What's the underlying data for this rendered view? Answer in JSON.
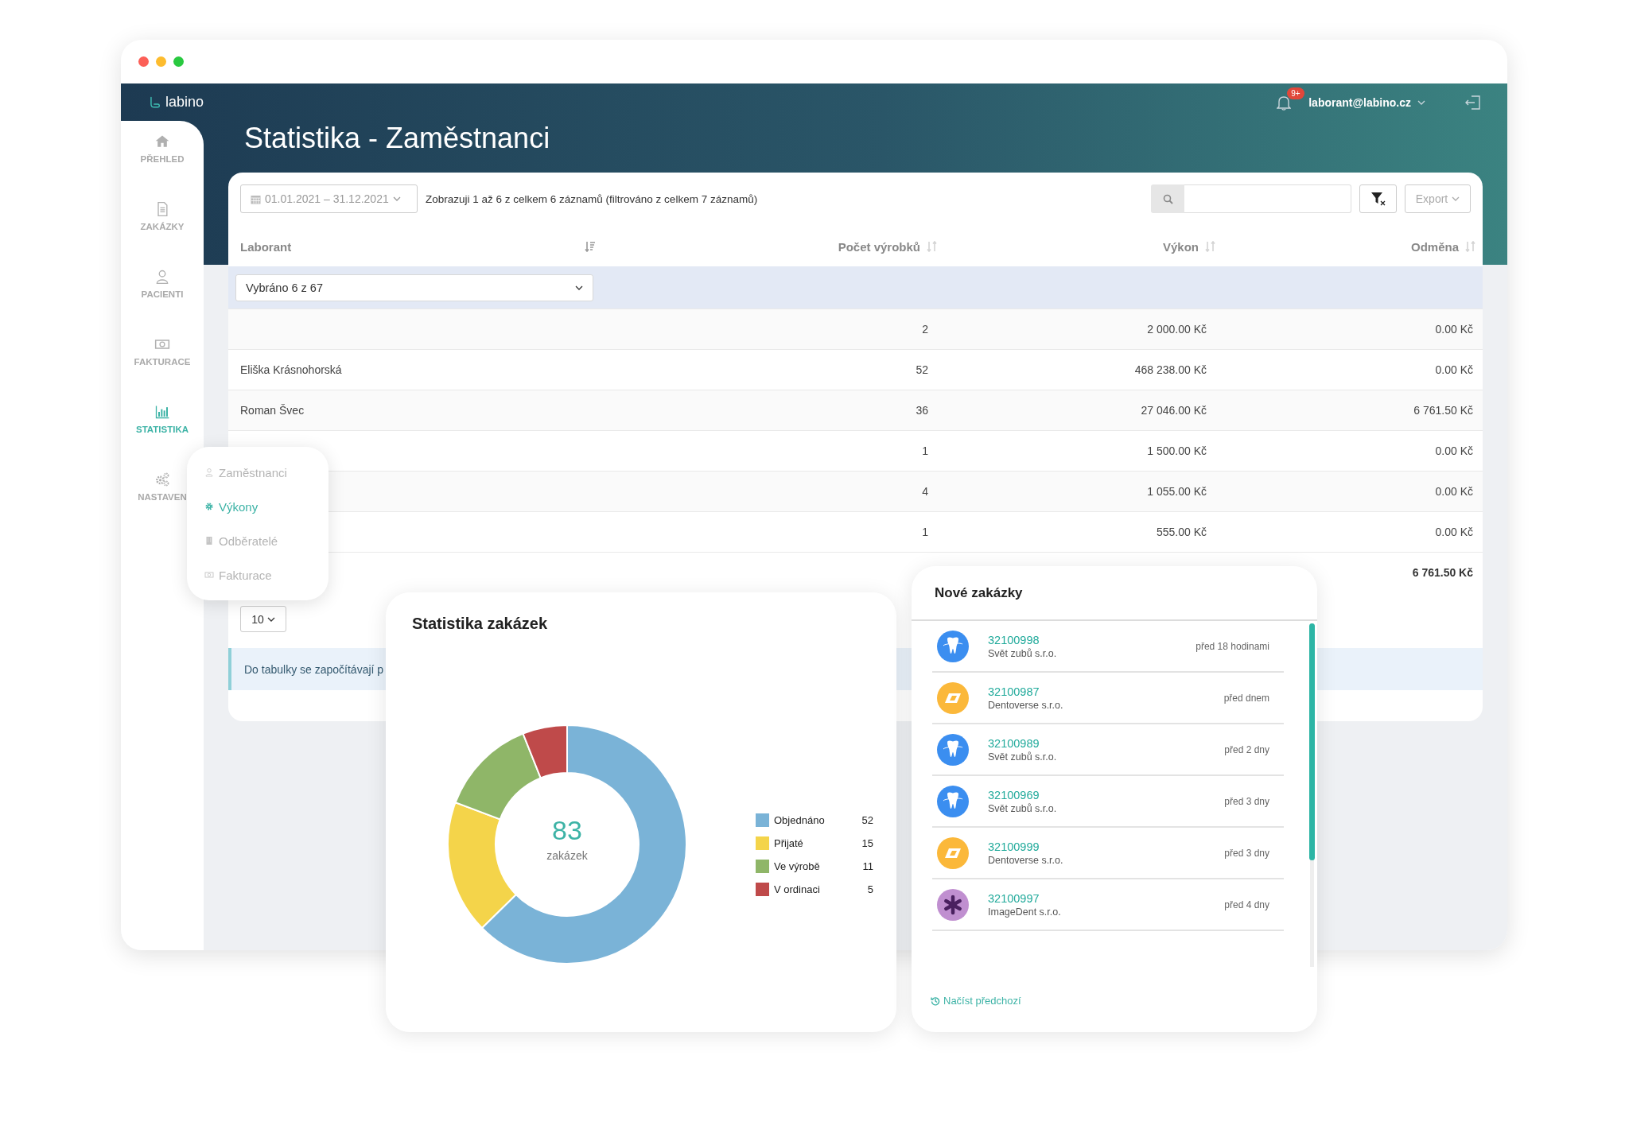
{
  "logo": "labino",
  "header": {
    "notifications_badge": "9+",
    "user": "laborant@labino.cz"
  },
  "sidebar": {
    "items": [
      {
        "label": "PŘEHLED",
        "kind": "home",
        "selected": false
      },
      {
        "label": "ZAKÁZKY",
        "kind": "document",
        "selected": false
      },
      {
        "label": "PACIENTI",
        "kind": "person",
        "selected": false
      },
      {
        "label": "FAKTURACE",
        "kind": "banknote",
        "selected": false
      },
      {
        "label": "STATISTIKA",
        "kind": "chart",
        "selected": true
      },
      {
        "label": "NASTAVEN",
        "kind": "gears",
        "selected": false
      }
    ]
  },
  "page_title": "Statistika - Zaměstnanci",
  "table": {
    "date_range": "01.01.2021 – 31.12.2021",
    "info": "Zobrazuji 1 až 6 z celkem 6 záznamů (filtrováno z celkem 7 záznamů)",
    "export": "Export",
    "columns": [
      {
        "label": "Laborant",
        "sorted": true
      },
      {
        "label": "Počet výrobků",
        "sorted": false
      },
      {
        "label": "Výkon",
        "sorted": false
      },
      {
        "label": "Odměna",
        "sorted": false
      }
    ],
    "filter": "Vybráno 6 z 67",
    "rows": [
      {
        "count": "2",
        "performance": "2 000.00 Kč",
        "reward": "0.00 Kč"
      },
      {
        "laborant": "Eliška Krásnohorská",
        "count": "52",
        "performance": "468 238.00 Kč",
        "reward": "0.00 Kč"
      },
      {
        "laborant": "Roman Švec",
        "count": "36",
        "performance": "27 046.00 Kč",
        "reward": "6 761.50 Kč"
      },
      {
        "count": "1",
        "performance": "1 500.00 Kč",
        "reward": "0.00 Kč"
      },
      {
        "count": "4",
        "performance": "1 055.00 Kč",
        "reward": "0.00 Kč"
      },
      {
        "count": "1",
        "performance": "555.00 Kč",
        "reward": "0.00 Kč"
      }
    ],
    "total": {
      "reward": "6 761.50 Kč"
    },
    "page_size": "10",
    "note": "Do tabulky se započítávají p"
  },
  "submenu": {
    "items": [
      {
        "label": "Zaměstnanci",
        "kind": "person",
        "selected": false
      },
      {
        "label": "Výkony",
        "kind": "gear",
        "selected": true
      },
      {
        "label": "Odběratelé",
        "kind": "building",
        "selected": false
      },
      {
        "label": "Fakturace",
        "kind": "banknote",
        "selected": false
      }
    ]
  },
  "order_stats": {
    "title": "Statistika zakázek",
    "total": "83",
    "total_label": "zakázek",
    "chart_data": {
      "type": "donut",
      "categories": [
        "Objednáno",
        "Přijaté",
        "Ve výrobě",
        "V ordinaci"
      ],
      "values": [
        62.65,
        18.07,
        13.25,
        6.03
      ]
    },
    "legend": [
      {
        "value": "52",
        "color": "#7ab3d7"
      },
      {
        "value": "15",
        "color": "#f4d44a"
      },
      {
        "value": "11",
        "color": "#8fb668"
      },
      {
        "value": "5",
        "color": "#bf4a4a"
      }
    ]
  },
  "new_orders": {
    "title": "Nové zakázky",
    "items": [
      {
        "id": "32100998",
        "client": "Svět zubů s.r.o.",
        "time": "před 18 hodinami",
        "kind": "tooth",
        "color": "#3b8ef0"
      },
      {
        "id": "32100987",
        "client": "Dentoverse s.r.o.",
        "time": "před dnem",
        "kind": "slash",
        "color": "#fbb83a"
      },
      {
        "id": "32100989",
        "client": "Svět zubů s.r.o.",
        "time": "před 2 dny",
        "kind": "tooth",
        "color": "#3b8ef0"
      },
      {
        "id": "32100969",
        "client": "Svět zubů s.r.o.",
        "time": "před 3 dny",
        "kind": "tooth",
        "color": "#3b8ef0"
      },
      {
        "id": "32100999",
        "client": "Dentoverse s.r.o.",
        "time": "před 3 dny",
        "kind": "slash",
        "color": "#fbb83a"
      },
      {
        "id": "32100997",
        "client": "ImageDent s.r.o.",
        "time": "před 4 dny",
        "kind": "asterisk",
        "color": "#c08fd0"
      }
    ],
    "load_more": "Načíst předchozí"
  }
}
